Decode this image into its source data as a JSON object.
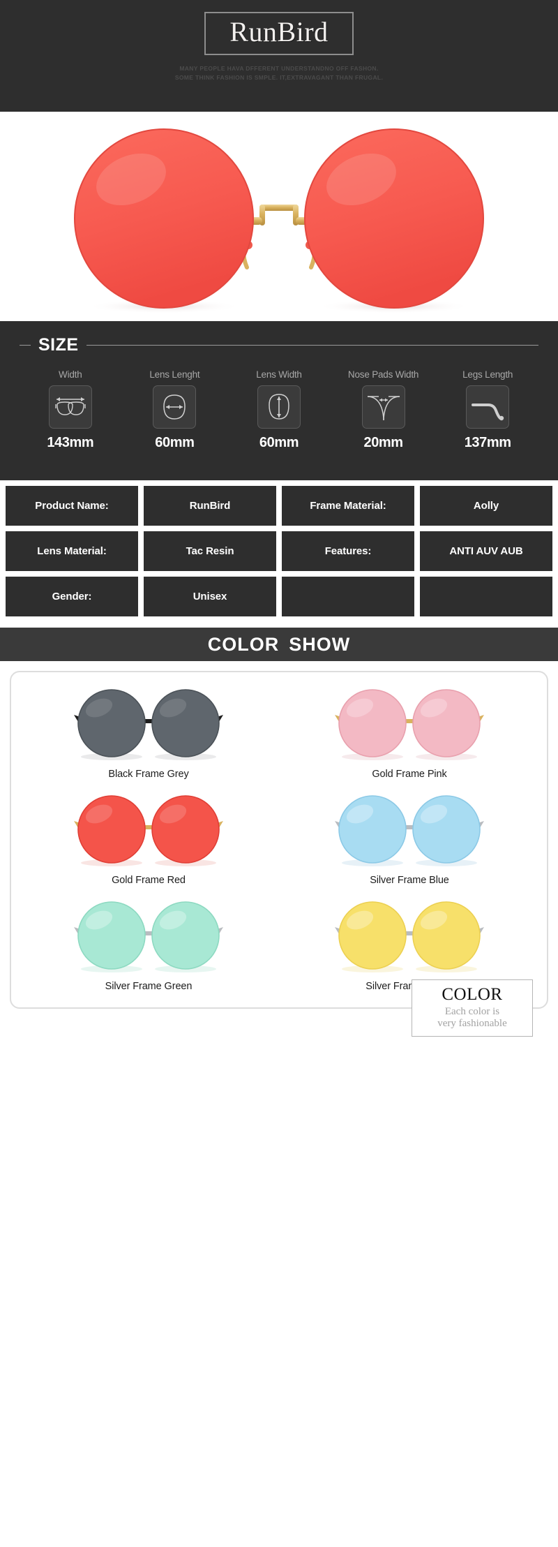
{
  "header": {
    "brand": "RunBird",
    "tagline_line1": "MANY PEOPLE HAVA DFFERENT UNDERSTANDNO OFF FASHON.",
    "tagline_line2": "SOME THINK FASHION IS SMPLE. IT,EXTRAVAGANT THAN FRUGAL.",
    "bg_color": "#2e2e2e"
  },
  "hero": {
    "alt": "round rimless red lens sunglasses front view",
    "lens_color": "#f75a50",
    "frame_color": "#d9b25f",
    "bg_color": "#ffffff"
  },
  "size": {
    "title": "SIZE",
    "columns": [
      {
        "label": "Width",
        "value": "143mm",
        "icon": "frame-width-icon"
      },
      {
        "label": "Lens Lenght",
        "value": "60mm",
        "icon": "lens-length-icon"
      },
      {
        "label": "Lens Width",
        "value": "60mm",
        "icon": "lens-width-icon"
      },
      {
        "label": "Nose Pads Width",
        "value": "20mm",
        "icon": "nose-pads-width-icon"
      },
      {
        "label": "Legs Length",
        "value": "137mm",
        "icon": "legs-length-icon"
      }
    ]
  },
  "spec_table": {
    "rows": [
      [
        {
          "text": "Product Name:",
          "kind": "label"
        },
        {
          "text": "RunBird",
          "kind": "value"
        },
        {
          "text": "Frame Material:",
          "kind": "label"
        },
        {
          "text": "Aolly",
          "kind": "value"
        }
      ],
      [
        {
          "text": "Lens Material:",
          "kind": "label"
        },
        {
          "text": "Tac Resin",
          "kind": "value"
        },
        {
          "text": "Features:",
          "kind": "label"
        },
        {
          "text": "ANTI AUV AUB",
          "kind": "value"
        }
      ],
      [
        {
          "text": "Gender:",
          "kind": "label"
        },
        {
          "text": "Unisex",
          "kind": "value"
        },
        {
          "text": "",
          "kind": "empty"
        },
        {
          "text": "",
          "kind": "empty"
        }
      ]
    ]
  },
  "color_show": {
    "banner_word1": "COLOR",
    "banner_word2": "SHOW",
    "variants": [
      {
        "name": "Black Frame Grey",
        "lens": "#5f666d",
        "lens_edge": "#4b5258",
        "frame": "#1d1d1d",
        "temple": "#3c4248"
      },
      {
        "name": "Gold Frame Pink",
        "lens": "#f3b9c4",
        "lens_edge": "#e8a0ad",
        "frame": "#d9b25f",
        "temple": "#f0a8b2"
      },
      {
        "name": "Gold Frame Red",
        "lens": "#f4544a",
        "lens_edge": "#e03f36",
        "frame": "#d9b25f",
        "temple": "#f2695e"
      },
      {
        "name": "Silver Frame Blue",
        "lens": "#a8dcf2",
        "lens_edge": "#8cc9e6",
        "frame": "#b9bcc0",
        "temple": "#9fd2ea"
      },
      {
        "name": "Silver Frame Green",
        "lens": "#a8e8d4",
        "lens_edge": "#8dd9c1",
        "frame": "#b9bcc0",
        "temple": "#9fe0ca"
      },
      {
        "name": "Silver Frame Yellow",
        "lens": "#f7e06a",
        "lens_edge": "#ecd052",
        "frame": "#b9bcc0",
        "temple": "#f3d95f"
      }
    ],
    "callout_title": "COLOR",
    "callout_line1": "Each color is",
    "callout_line2": "very fashionable"
  }
}
